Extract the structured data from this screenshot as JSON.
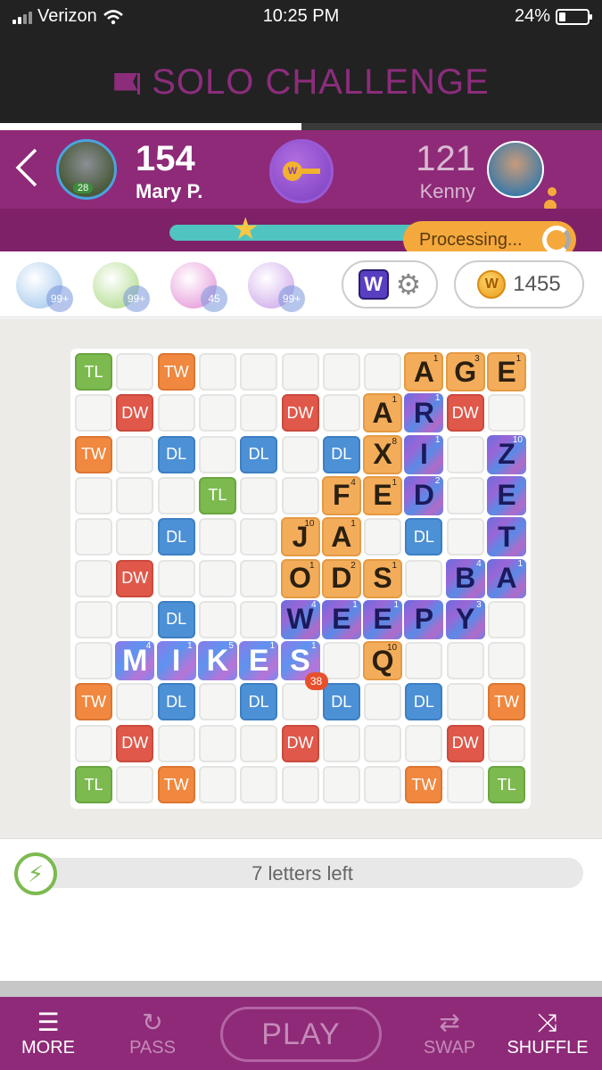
{
  "status_bar": {
    "carrier": "Verizon",
    "time": "10:25 PM",
    "battery": "24%",
    "battery_level": 0.24
  },
  "title": "SOLO CHALLENGE",
  "game_progress": 0.5,
  "player": {
    "score": "154",
    "name": "Mary P.",
    "level": "28"
  },
  "opponent": {
    "score": "121",
    "name": "Kenny"
  },
  "key_coin_letter": "W",
  "processing_label": "Processing...",
  "powerups": [
    {
      "name": "hindsight",
      "count": "99+",
      "color": "#9bc3ea"
    },
    {
      "name": "word-radar",
      "count": "99+",
      "color": "#a6d67c"
    },
    {
      "name": "swap-plus",
      "count": "45",
      "color": "#e28ad4"
    },
    {
      "name": "word-search",
      "count": "99+",
      "color": "#c99ee8"
    }
  ],
  "settings_logo": "W",
  "coins": {
    "logo": "W",
    "amount": "1455"
  },
  "board": {
    "premium_squares": [
      {
        "r": 0,
        "c": 0,
        "t": "TL"
      },
      {
        "r": 0,
        "c": 2,
        "t": "TW"
      },
      {
        "r": 0,
        "c": 8,
        "t": "TW"
      },
      {
        "r": 0,
        "c": 10,
        "t": "TL"
      },
      {
        "r": 1,
        "c": 1,
        "t": "DW"
      },
      {
        "r": 1,
        "c": 5,
        "t": "DW"
      },
      {
        "r": 1,
        "c": 9,
        "t": "DW"
      },
      {
        "r": 2,
        "c": 0,
        "t": "TW"
      },
      {
        "r": 2,
        "c": 2,
        "t": "DL"
      },
      {
        "r": 2,
        "c": 4,
        "t": "DL"
      },
      {
        "r": 2,
        "c": 6,
        "t": "DL"
      },
      {
        "r": 2,
        "c": 8,
        "t": "DL"
      },
      {
        "r": 2,
        "c": 10,
        "t": "TW"
      },
      {
        "r": 3,
        "c": 3,
        "t": "TL"
      },
      {
        "r": 3,
        "c": 7,
        "t": "TL"
      },
      {
        "r": 4,
        "c": 2,
        "t": "DL"
      },
      {
        "r": 4,
        "c": 8,
        "t": "DL"
      },
      {
        "r": 5,
        "c": 1,
        "t": "DW"
      },
      {
        "r": 5,
        "c": 9,
        "t": "DW"
      },
      {
        "r": 6,
        "c": 2,
        "t": "DL"
      },
      {
        "r": 6,
        "c": 8,
        "t": "DL"
      },
      {
        "r": 7,
        "c": 3,
        "t": "TL"
      },
      {
        "r": 7,
        "c": 7,
        "t": "TL"
      },
      {
        "r": 8,
        "c": 0,
        "t": "TW"
      },
      {
        "r": 8,
        "c": 2,
        "t": "DL"
      },
      {
        "r": 8,
        "c": 4,
        "t": "DL"
      },
      {
        "r": 8,
        "c": 6,
        "t": "DL"
      },
      {
        "r": 8,
        "c": 8,
        "t": "DL"
      },
      {
        "r": 8,
        "c": 10,
        "t": "TW"
      },
      {
        "r": 9,
        "c": 1,
        "t": "DW"
      },
      {
        "r": 9,
        "c": 5,
        "t": "DW"
      },
      {
        "r": 9,
        "c": 9,
        "t": "DW"
      },
      {
        "r": 10,
        "c": 0,
        "t": "TL"
      },
      {
        "r": 10,
        "c": 2,
        "t": "TW"
      },
      {
        "r": 10,
        "c": 8,
        "t": "TW"
      },
      {
        "r": 10,
        "c": 10,
        "t": "TL"
      }
    ],
    "tiles": [
      {
        "r": 0,
        "c": 8,
        "l": "A",
        "p": "1",
        "s": "old"
      },
      {
        "r": 0,
        "c": 9,
        "l": "G",
        "p": "3",
        "s": "old"
      },
      {
        "r": 0,
        "c": 10,
        "l": "E",
        "p": "1",
        "s": "old"
      },
      {
        "r": 1,
        "c": 7,
        "l": "A",
        "p": "1",
        "s": "old"
      },
      {
        "r": 1,
        "c": 8,
        "l": "R",
        "p": "1",
        "s": "fx"
      },
      {
        "r": 2,
        "c": 7,
        "l": "X",
        "p": "8",
        "s": "old"
      },
      {
        "r": 2,
        "c": 8,
        "l": "I",
        "p": "1",
        "s": "fx"
      },
      {
        "r": 2,
        "c": 10,
        "l": "Z",
        "p": "10",
        "s": "fx"
      },
      {
        "r": 3,
        "c": 6,
        "l": "F",
        "p": "4",
        "s": "old"
      },
      {
        "r": 3,
        "c": 7,
        "l": "E",
        "p": "1",
        "s": "old"
      },
      {
        "r": 3,
        "c": 8,
        "l": "D",
        "p": "2",
        "s": "fx"
      },
      {
        "r": 3,
        "c": 10,
        "l": "E",
        "p": "",
        "s": "fx"
      },
      {
        "r": 4,
        "c": 5,
        "l": "J",
        "p": "10",
        "s": "old"
      },
      {
        "r": 4,
        "c": 6,
        "l": "A",
        "p": "1",
        "s": "old"
      },
      {
        "r": 4,
        "c": 10,
        "l": "T",
        "p": "",
        "s": "fx"
      },
      {
        "r": 5,
        "c": 5,
        "l": "O",
        "p": "1",
        "s": "old"
      },
      {
        "r": 5,
        "c": 6,
        "l": "D",
        "p": "2",
        "s": "old"
      },
      {
        "r": 5,
        "c": 7,
        "l": "S",
        "p": "1",
        "s": "old"
      },
      {
        "r": 5,
        "c": 9,
        "l": "B",
        "p": "4",
        "s": "fx"
      },
      {
        "r": 5,
        "c": 10,
        "l": "A",
        "p": "1",
        "s": "fx"
      },
      {
        "r": 6,
        "c": 5,
        "l": "W",
        "p": "4",
        "s": "fx"
      },
      {
        "r": 6,
        "c": 6,
        "l": "E",
        "p": "1",
        "s": "fx"
      },
      {
        "r": 6,
        "c": 7,
        "l": "E",
        "p": "1",
        "s": "fx"
      },
      {
        "r": 6,
        "c": 8,
        "l": "P",
        "p": "",
        "s": "fx"
      },
      {
        "r": 6,
        "c": 9,
        "l": "Y",
        "p": "3",
        "s": "fx"
      },
      {
        "r": 7,
        "c": 1,
        "l": "M",
        "p": "4",
        "s": "mine"
      },
      {
        "r": 7,
        "c": 2,
        "l": "I",
        "p": "1",
        "s": "mine"
      },
      {
        "r": 7,
        "c": 3,
        "l": "K",
        "p": "5",
        "s": "mine"
      },
      {
        "r": 7,
        "c": 4,
        "l": "E",
        "p": "1",
        "s": "mine"
      },
      {
        "r": 7,
        "c": 5,
        "l": "S",
        "p": "1",
        "s": "mine"
      },
      {
        "r": 7,
        "c": 7,
        "l": "Q",
        "p": "10",
        "s": "old"
      }
    ],
    "move_score": "38"
  },
  "letters_left": "7 letters left",
  "bottom_bar": {
    "more": "MORE",
    "pass": "PASS",
    "play": "PLAY",
    "swap": "SWAP",
    "shuffle": "SHUFFLE"
  },
  "colors": {
    "brand": "#8e2a78",
    "triple_letter": "#7cba4f",
    "triple_word": "#f0883f",
    "double_letter": "#4c90d6",
    "double_word": "#e0584a",
    "tile": "#f3ad5a"
  }
}
